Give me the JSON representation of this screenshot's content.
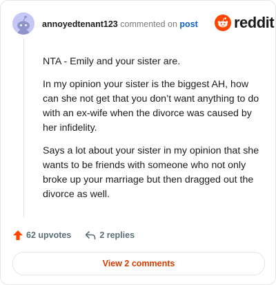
{
  "comment": {
    "username": "annoyedtenant123",
    "commented_on_text": "commented on",
    "post_link_text": "post",
    "paragraphs": [
      "NTA - Emily and your sister are.",
      "In my opinion your sister is the biggest AH, how can she not get that you don’t want anything to do with an ex-wife when the divorce was caused by her infidelity.",
      "Says a lot about your sister in my opinion that she wants to be friends with someone who not only broke up your marriage but then dragged out the divorce as well."
    ]
  },
  "brand": {
    "wordmark": "reddit",
    "logo_icon": "reddit-snoo-icon",
    "accent_color": "#ff4500"
  },
  "actions": {
    "upvotes_label": "62 upvotes",
    "replies_label": "2 replies",
    "upvote_icon": "upvote-arrow-icon",
    "reply_icon": "reply-arrow-icon"
  },
  "footer": {
    "view_comments_label": "View 2 comments",
    "link_color": "#d93a00"
  }
}
